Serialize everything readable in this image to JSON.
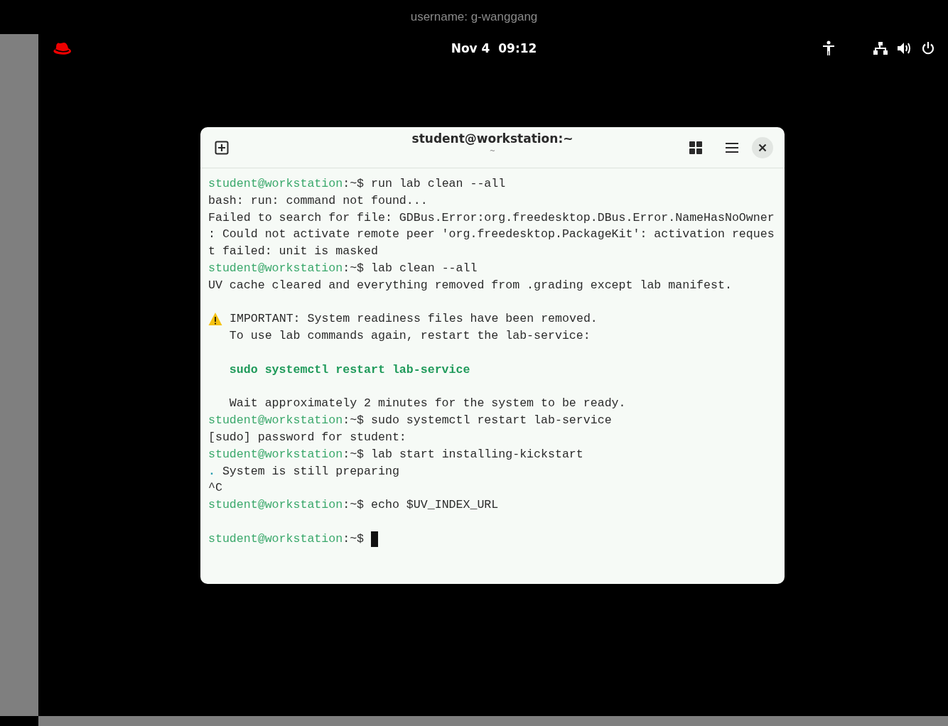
{
  "banner": {
    "text": "username: g-wanggang"
  },
  "panel": {
    "clock": "Nov 4  09:12"
  },
  "terminal": {
    "title": "student@workstation:~",
    "subtitle": "~",
    "lines": [
      {
        "kind": "prompt",
        "user": "student@workstation",
        "path": ":~$",
        "command": "run lab clean --all"
      },
      {
        "kind": "output",
        "text": "bash: run: command not found..."
      },
      {
        "kind": "output",
        "text": "Failed to search for file: GDBus.Error:org.freedesktop.DBus.Error.NameHasNoOwner"
      },
      {
        "kind": "output",
        "text": ": Could not activate remote peer 'org.freedesktop.PackageKit': activation reques"
      },
      {
        "kind": "output",
        "text": "t failed: unit is masked"
      },
      {
        "kind": "prompt",
        "user": "student@workstation",
        "path": ":~$",
        "command": "lab clean --all"
      },
      {
        "kind": "output",
        "text": "UV cache cleared and everything removed from .grading except lab manifest."
      },
      {
        "kind": "blank"
      },
      {
        "kind": "warning",
        "text": "IMPORTANT: System readiness files have been removed."
      },
      {
        "kind": "note",
        "text": "To use lab commands again, restart the lab-service:"
      },
      {
        "kind": "blank"
      },
      {
        "kind": "highlight",
        "text": "sudo systemctl restart lab-service"
      },
      {
        "kind": "blank"
      },
      {
        "kind": "note",
        "text": "Wait approximately 2 minutes for the system to be ready."
      },
      {
        "kind": "prompt",
        "user": "student@workstation",
        "path": ":~$",
        "command": "sudo systemctl restart lab-service"
      },
      {
        "kind": "output",
        "text": "[sudo] password for student:"
      },
      {
        "kind": "prompt",
        "user": "student@workstation",
        "path": ":~$",
        "command": "lab start installing-kickstart"
      },
      {
        "kind": "progress",
        "spinner": ".",
        "text": "System is still preparing"
      },
      {
        "kind": "output",
        "text": "^C"
      },
      {
        "kind": "prompt",
        "user": "student@workstation",
        "path": ":~$",
        "command": "echo $UV_INDEX_URL"
      },
      {
        "kind": "blank"
      },
      {
        "kind": "prompt",
        "user": "student@workstation",
        "path": ":~$",
        "cursor": true
      }
    ]
  }
}
